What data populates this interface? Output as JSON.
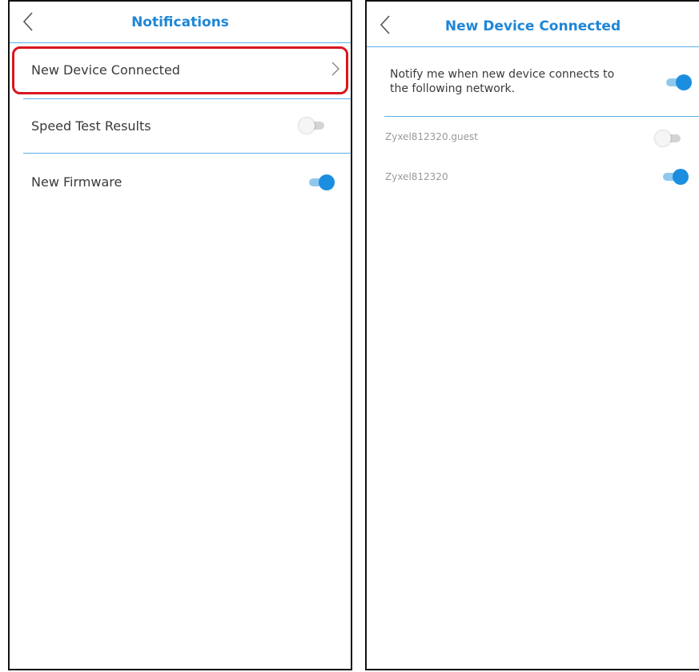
{
  "left_screen": {
    "title": "Notifications",
    "items": [
      {
        "label": "New Device Connected",
        "control": "chevron",
        "highlighted": true
      },
      {
        "label": "Speed Test Results",
        "control": "toggle",
        "state": "off"
      },
      {
        "label": "New Firmware",
        "control": "toggle",
        "state": "on"
      }
    ]
  },
  "right_screen": {
    "title": "New Device Connected",
    "notify_text_line1": "Notify me when new device connects to",
    "notify_text_line2": "the following network.",
    "notify_toggle": "on",
    "networks": [
      {
        "name": "Zyxel812320.guest",
        "state": "off"
      },
      {
        "name": "Zyxel812320",
        "state": "on"
      }
    ]
  },
  "colors": {
    "accent": "#1f86d6",
    "toggle_on": "#1b8ee0",
    "divider": "#5ab0e6",
    "highlight": "#d9161f"
  }
}
